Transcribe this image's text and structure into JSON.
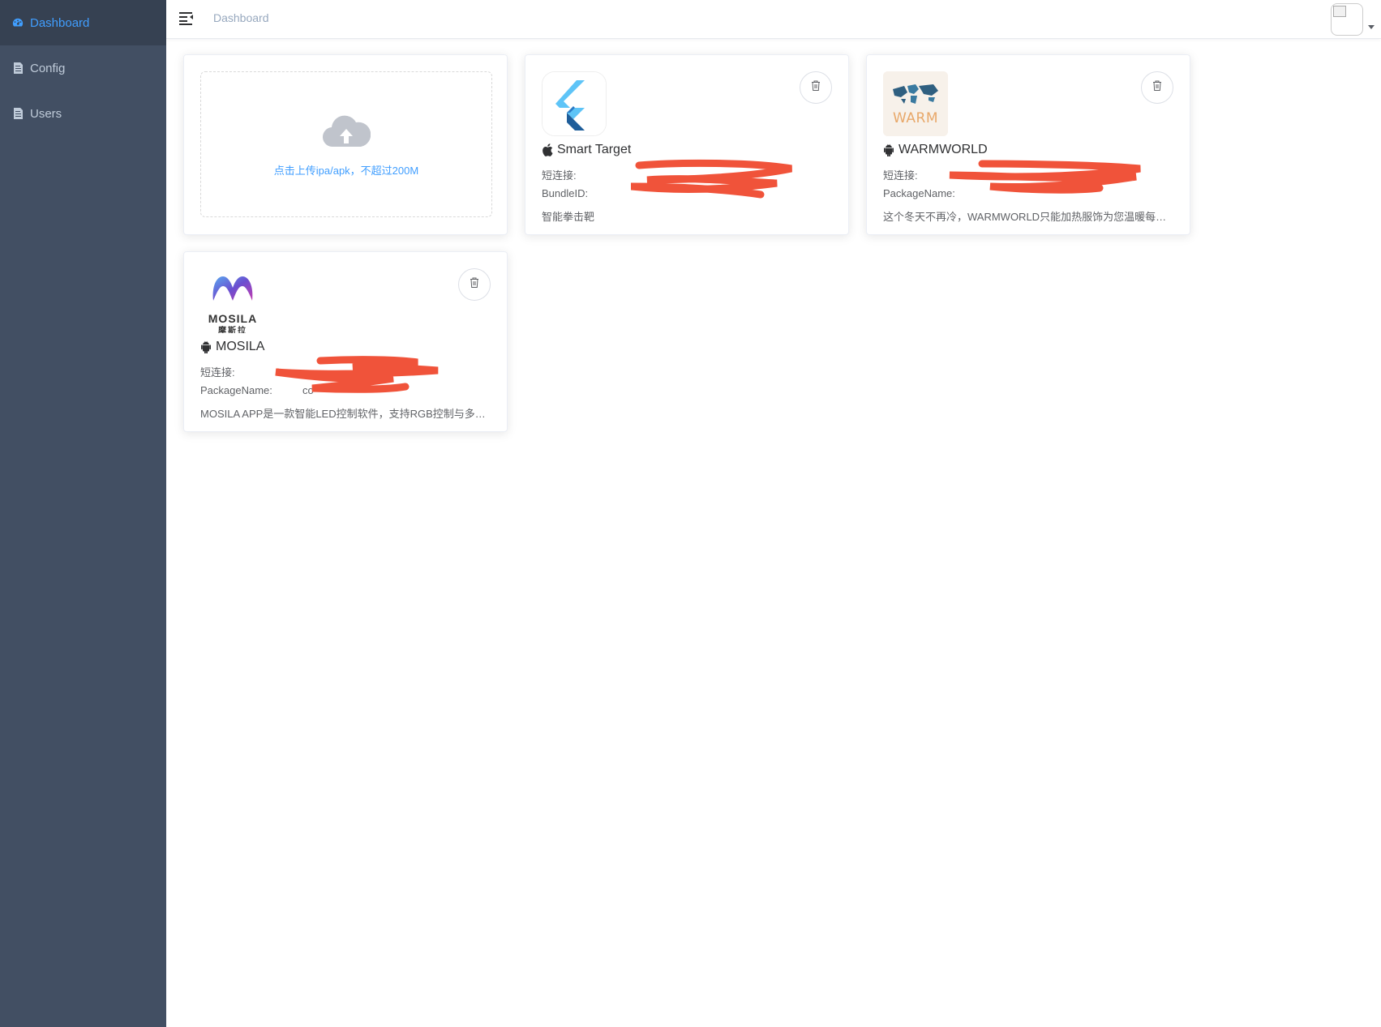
{
  "sidebar": {
    "items": [
      {
        "label": "Dashboard",
        "icon": "dashboard-icon",
        "active": true
      },
      {
        "label": "Config",
        "icon": "document-icon",
        "active": false
      },
      {
        "label": "Users",
        "icon": "document-icon",
        "active": false
      }
    ]
  },
  "navbar": {
    "breadcrumb": "Dashboard",
    "hamburger_icon": "hamburger-icon",
    "avatar_icon": "broken-image-icon"
  },
  "upload": {
    "text": "点击上传ipa/apk，不超过200M",
    "icon": "upload-cloud-icon"
  },
  "apps": [
    {
      "name": "Smart Target",
      "platform": "ios",
      "short_link_label": "短连接:",
      "short_link_value": "",
      "id_label": "BundleID:",
      "id_value": "",
      "description": "智能拳击靶",
      "logo": "flutter-logo"
    },
    {
      "name": "WARMWORLD",
      "platform": "android",
      "short_link_label": "短连接:",
      "short_link_value": "",
      "id_label": "PackageName:",
      "id_value": "",
      "description": "这个冬天不再冷，WARMWORLD只能加热服饰为您温暖每一天",
      "logo": "warm-logo",
      "logo_text": "WARM"
    },
    {
      "name": "MOSILA",
      "platform": "android",
      "short_link_label": "短连接:",
      "short_link_value": "",
      "id_label": "PackageName:",
      "id_value": "co",
      "description": "MOSILA APP是一款智能LED控制软件，支持RGB控制与多种灯光模式",
      "logo": "mosila-logo",
      "logo_text": "MOSILA",
      "logo_subtext": "摩斯拉"
    }
  ],
  "colors": {
    "sidebar_bg": "#424f63",
    "sidebar_active_bg": "#364152",
    "accent": "#409eff",
    "redaction": "#f0533a"
  }
}
